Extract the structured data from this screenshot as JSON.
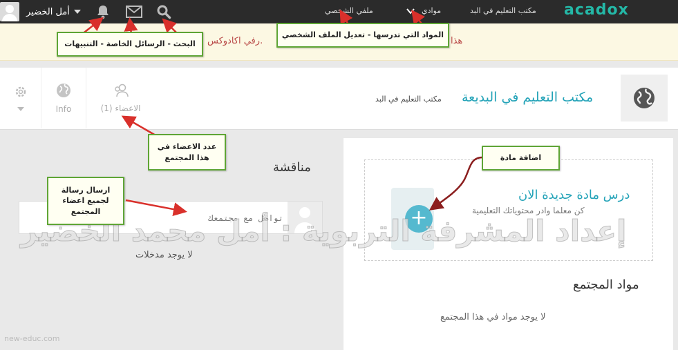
{
  "topnav": {
    "user_name": "أمل الخضير",
    "links": {
      "profile": "ملفي الشخصي",
      "my_subjects": "موادي",
      "community": "مكتب التعليم في البد"
    },
    "logo": "acadox",
    "icons": [
      "bell-icon",
      "envelope-icon",
      "search-icon"
    ]
  },
  "notice": {
    "left_text": "هذا",
    "right_text": "رفي اكادوكس."
  },
  "community": {
    "title": "مكتب التعليم في البديعة",
    "subtitle": "مكتب التعليم في البد",
    "tabs": {
      "members": "الاعضاء (1)",
      "info": "Info"
    }
  },
  "discussion": {
    "title": "مناقشة",
    "post_placeholder": "تواصل مع مجتمعك",
    "empty": "لا يوجد مدخلات"
  },
  "subjects": {
    "new_title": "درس مادة جديدة الان",
    "new_subtitle": "كن معلما وادر محتوياتك التعليمية",
    "title": "مواد المجتمع",
    "empty": "لا يوجد مواد في هذا المجتمع"
  },
  "callouts": {
    "search_messages_alerts": "البحث - الرسائل الخاصة - التنبيهات",
    "subjects_profile": "المواد التي تدرسها - تعديل الملف الشخصي",
    "members_count": "عدد الاعضاء في هذا المجتمع",
    "message_all": "ارسال رسالة لجميع اعضاء المجتمع",
    "add_subject": "اضافة مادة"
  },
  "watermark": "إعداد المشرفة التربوية : أمل محمد الخضير",
  "footer_site": "new-educ.com",
  "colors": {
    "brand": "#24b8a7",
    "link": "#24a3b8",
    "callout_border": "#5fa535",
    "arrow": "#d9302b"
  }
}
